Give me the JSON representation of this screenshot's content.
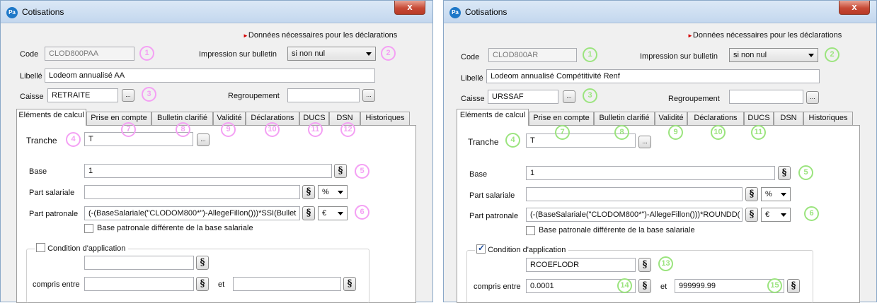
{
  "windows": [
    {
      "title": "Cotisations",
      "app_icon": "Pa",
      "declarations_link": "Données nécessaires pour les déclarations",
      "code_label": "Code",
      "code_value": "CLOD800PAA",
      "impression_label": "Impression sur bulletin",
      "impression_value": "si non nul",
      "libelle_label": "Libellé",
      "libelle_value": "Lodeom annualisé AA",
      "caisse_label": "Caisse",
      "caisse_value": "RETRAITE",
      "regroupement_label": "Regroupement",
      "regroupement_value": "",
      "ellipsis": "...",
      "tabs": [
        "Eléments de calcul",
        "Prise en compte",
        "Bulletin clarifié",
        "Validité",
        "Déclarations",
        "DUCS",
        "DSN",
        "Historiques"
      ],
      "tranche_label": "Tranche",
      "tranche_value": "T",
      "base_label": "Base",
      "base_value": "1",
      "part_salariale_label": "Part salariale",
      "part_salariale_value": "",
      "part_salariale_unit": "%",
      "part_patronale_label": "Part patronale",
      "part_patronale_value": "(-(BaseSalariale(\"CLODOM800*\")-AllegeFillon()))*SSI(Bullet",
      "part_patronale_unit": "€",
      "base_diff_label": "Base patronale différente de la base salariale",
      "base_diff_checked": false,
      "condition_label": "Condition d'application",
      "condition_checked": false,
      "condition_value": "",
      "compris_label": "compris entre",
      "compris_min": "",
      "et_label": "et",
      "compris_max": "",
      "para_symbol": "§",
      "marker_color": "#f4a0f4",
      "markers": [
        "1",
        "2",
        "3",
        "4",
        "5",
        "6",
        "7",
        "8",
        "9",
        "10",
        "11",
        "12"
      ]
    },
    {
      "title": "Cotisations",
      "app_icon": "Pa",
      "declarations_link": "Données nécessaires pour les déclarations",
      "code_label": "Code",
      "code_value": "CLOD800AR",
      "impression_label": "Impression sur bulletin",
      "impression_value": "si non nul",
      "libelle_label": "Libellé",
      "libelle_value": "Lodeom annualisé Compétitivité Renf",
      "caisse_label": "Caisse",
      "caisse_value": "URSSAF",
      "regroupement_label": "Regroupement",
      "regroupement_value": "",
      "ellipsis": "...",
      "tabs": [
        "Eléments de calcul",
        "Prise en compte",
        "Bulletin clarifié",
        "Validité",
        "Déclarations",
        "DUCS",
        "DSN",
        "Historiques"
      ],
      "tranche_label": "Tranche",
      "tranche_value": "T",
      "base_label": "Base",
      "base_value": "1",
      "part_salariale_label": "Part salariale",
      "part_salariale_value": "",
      "part_salariale_unit": "%",
      "part_patronale_label": "Part patronale",
      "part_patronale_value": "(-(BaseSalariale(\"CLODOM800*\")-AllegeFillon()))*ROUNDD(",
      "part_patronale_unit": "€",
      "base_diff_label": "Base patronale différente de la base salariale",
      "base_diff_checked": false,
      "condition_label": "Condition d'application",
      "condition_checked": true,
      "condition_value": "RCOEFLODR",
      "compris_label": "compris entre",
      "compris_min": "0.0001",
      "et_label": "et",
      "compris_max": "999999.99",
      "para_symbol": "§",
      "marker_color": "#9be47e",
      "markers": [
        "1",
        "2",
        "3",
        "4",
        "5",
        "6",
        "7",
        "8",
        "9",
        "10",
        "11",
        "13",
        "14",
        "15"
      ]
    }
  ]
}
